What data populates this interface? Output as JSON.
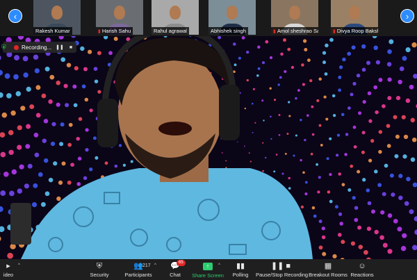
{
  "gallery": {
    "participants": [
      {
        "name": "Rakesh Kumar",
        "muted": false,
        "shirt": "#3a4a5a",
        "bg": "#4d5660"
      },
      {
        "name": "Harish Sahu",
        "muted": true,
        "shirt": "#7b6a9a",
        "bg": "#6a6e72"
      },
      {
        "name": "Rahul agrawal",
        "muted": false,
        "shirt": "#8d8d8d",
        "bg": "#a9a9a9"
      },
      {
        "name": "Abhishek singh",
        "muted": false,
        "shirt": "#1f2f48",
        "bg": "#7c8e98"
      },
      {
        "name": "Amol sheshrao Sa...",
        "muted": true,
        "shirt": "#d8d8d8",
        "bg": "#8a7660"
      },
      {
        "name": "Divya Roop Bakshi",
        "muted": true,
        "shirt": "#2c4a7e",
        "bg": "#9a8064"
      }
    ]
  },
  "recording": {
    "label": "Recording...",
    "pause_symbol": "❚❚",
    "stop_symbol": "■"
  },
  "toolbar": {
    "video_label": "ideo",
    "security_label": "Security",
    "participants_label": "Participants",
    "participants_count": "217",
    "chat_label": "Chat",
    "chat_badge": "65",
    "share_label": "Share Screen",
    "polling_label": "Polling",
    "record_label": "Pause/Stop Recording",
    "breakout_label": "Breakout Rooms",
    "reactions_label": "Reactions"
  },
  "colors": {
    "accent_blue": "#2d8cff",
    "share_green": "#2ecc71",
    "alert_red": "#e02828"
  },
  "icons": {
    "nav_left": "chevron-left-icon",
    "nav_right": "chevron-right-icon",
    "security": "shield-icon",
    "participants": "people-icon",
    "chat": "chat-bubble-icon",
    "share": "share-screen-icon",
    "polling": "bar-chart-icon",
    "record": "pause-stop-icon",
    "breakout": "breakout-grid-icon",
    "reactions": "smiley-icon"
  }
}
